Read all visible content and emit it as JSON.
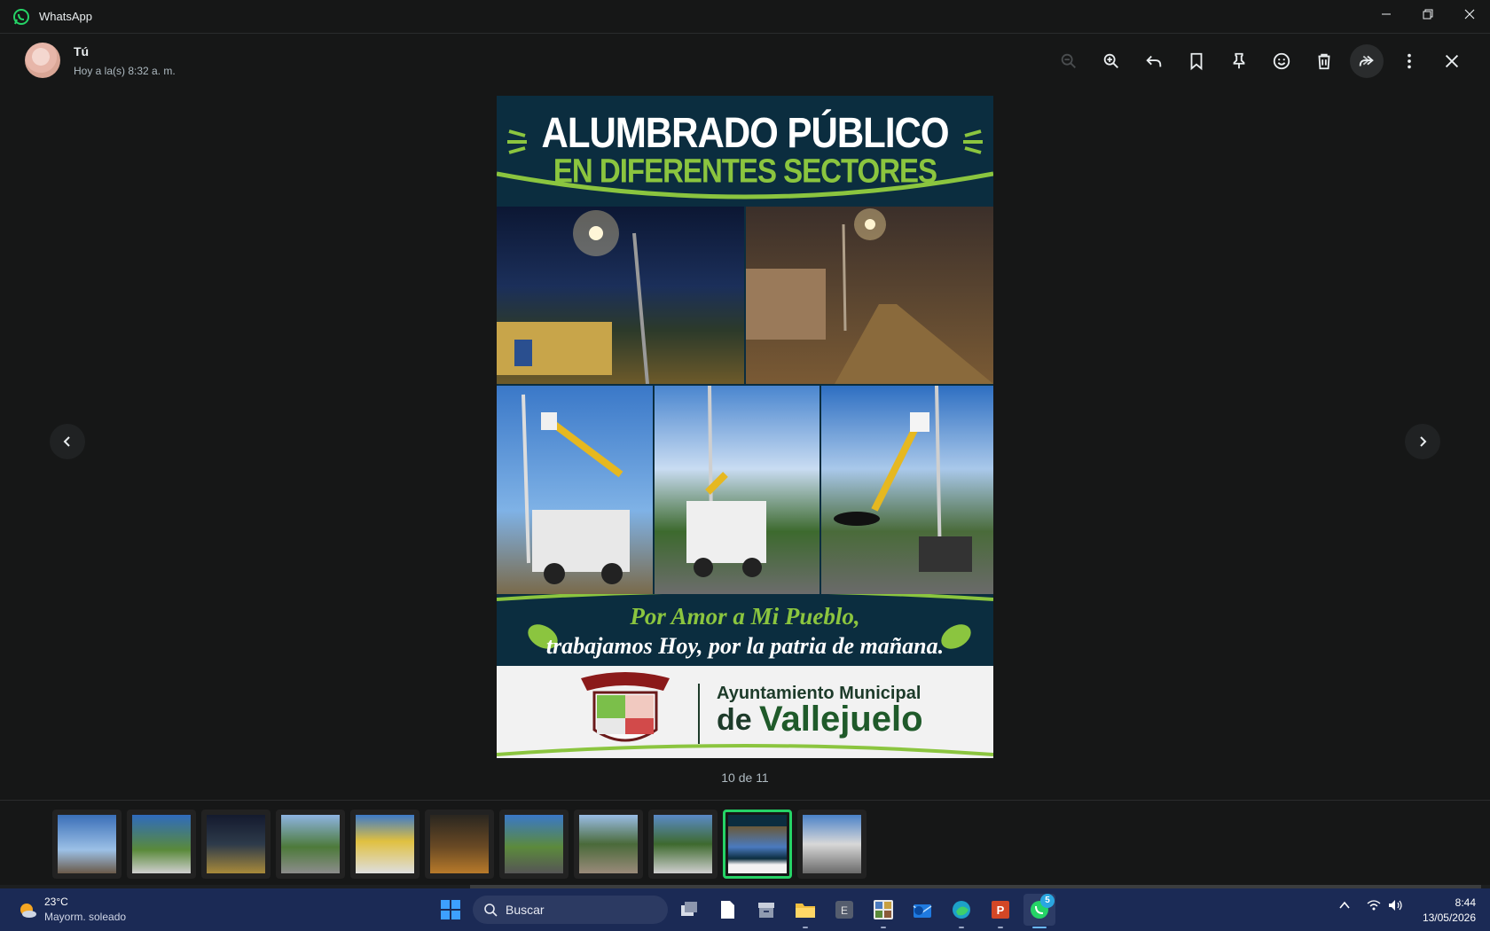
{
  "window": {
    "app_title": "WhatsApp"
  },
  "viewer": {
    "sender_name": "Tú",
    "timestamp": "Hoy a la(s) 8:32 a. m.",
    "counter": "10 de 11",
    "current_index": 10,
    "total": 11
  },
  "toolbar": {
    "icons": [
      "zoom-out-icon",
      "zoom-in-icon",
      "reply-icon",
      "bookmark-icon",
      "pin-icon",
      "emoji-icon",
      "delete-icon",
      "forward-icon",
      "more-options-icon",
      "close-icon"
    ]
  },
  "poster": {
    "title_line1": "ALUMBRADO PÚBLICO",
    "title_line2": "EN DIFERENTES SECTORES",
    "slogan_line1": "Por Amor a Mi Pueblo,",
    "slogan_line2": "trabajamos Hoy, por la patria de mañana.",
    "footer_line1": "Ayuntamiento Municipal",
    "footer_line2_prefix": "de",
    "footer_line2_name": "Vallejuelo"
  },
  "taskbar": {
    "weather_temp": "23°C",
    "weather_desc": "Mayorm. soleado",
    "search_placeholder": "Buscar",
    "whatsapp_badge": "5",
    "clock_time": "8:44",
    "clock_date": "13/05/2026"
  },
  "colors": {
    "accent": "#25d366",
    "poster_navy": "#0b2d3f",
    "poster_green": "#8bc53f",
    "taskbar": "#1b2a55"
  }
}
